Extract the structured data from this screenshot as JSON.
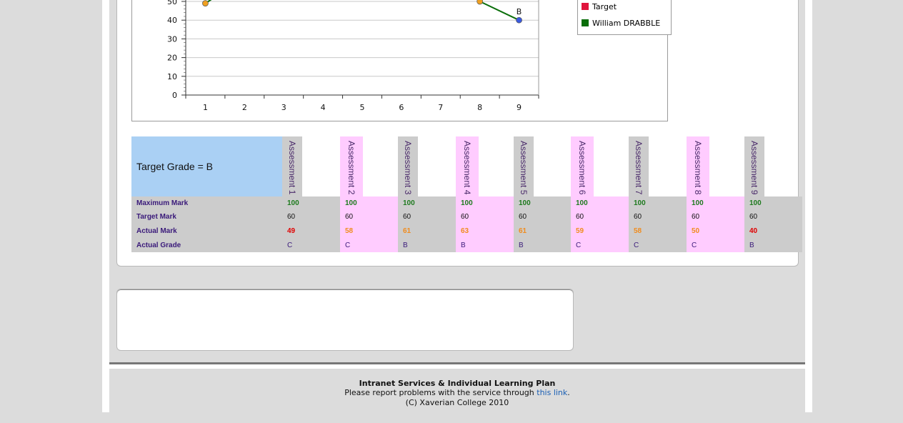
{
  "chart_data": {
    "type": "line",
    "x_ticks": [
      "1",
      "2",
      "3",
      "4",
      "5",
      "6",
      "7",
      "8",
      "9"
    ],
    "y_ticks": [
      "0",
      "10",
      "20",
      "30",
      "40",
      "50"
    ],
    "ylim": [
      0,
      50
    ],
    "series": [
      {
        "name": "William DRABBLE",
        "color": "#0a6e0a",
        "x": [
          1,
          8,
          9
        ],
        "y": [
          49,
          50,
          40
        ],
        "marker_colors": [
          "#f0a020",
          "#f0a020",
          "#3a5ae0"
        ]
      }
    ],
    "annotations": [
      {
        "x": 9,
        "y": 40,
        "text": "B"
      }
    ],
    "grid": true
  },
  "legend": {
    "items": [
      {
        "label": "Target",
        "color": "#e0143c"
      },
      {
        "label": "William DRABBLE",
        "color": "#0a6e0a"
      }
    ]
  },
  "table": {
    "target_grade": "Target Grade = B",
    "headers": [
      "Assessment 1",
      "Assessment 2",
      "Assessment 3",
      "Assessment 4",
      "Assessment 5",
      "Assessment 6",
      "Assessment 7",
      "Assessment 8",
      "Assessment 9"
    ],
    "row_labels": {
      "max": "Maximum Mark",
      "target": "Target Mark",
      "actual": "Actual Mark",
      "grade": "Actual Grade"
    },
    "max": [
      "100",
      "100",
      "100",
      "100",
      "100",
      "100",
      "100",
      "100",
      "100"
    ],
    "target": [
      "60",
      "60",
      "60",
      "60",
      "60",
      "60",
      "60",
      "60",
      "60"
    ],
    "actual": [
      "49",
      "58",
      "61",
      "63",
      "61",
      "59",
      "58",
      "50",
      "40"
    ],
    "actual_colors": [
      "#e00000",
      "#f08c1e",
      "#f08c1e",
      "#f08c1e",
      "#f08c1e",
      "#f08c1e",
      "#f08c1e",
      "#f08c1e",
      "#e00000"
    ],
    "grade": [
      "C",
      "C",
      "B",
      "B",
      "B",
      "C",
      "C",
      "C",
      "B"
    ],
    "column_colors": [
      "#cccccc",
      "#ffccff",
      "#cccccc",
      "#ffccff",
      "#cccccc",
      "#ffccff",
      "#cccccc",
      "#ffccff",
      "#cccccc"
    ]
  },
  "footer": {
    "title": "Intranet Services & Individual Learning Plan",
    "report_prefix": "Please report problems with the service through ",
    "report_link": "this link",
    "report_suffix": ".",
    "copyright": "(C) Xaverian College 2010"
  }
}
